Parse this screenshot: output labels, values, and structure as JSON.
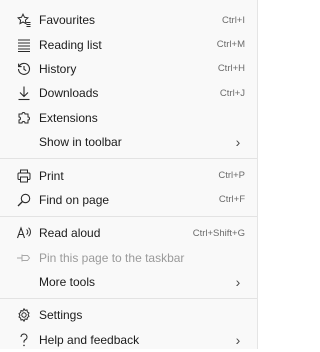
{
  "menu": {
    "groups": [
      {
        "items": [
          {
            "label": "Favourites",
            "shortcut": "Ctrl+I",
            "icon": "favourites-star-icon"
          },
          {
            "label": "Reading list",
            "shortcut": "Ctrl+M",
            "icon": "reading-list-icon"
          },
          {
            "label": "History",
            "shortcut": "Ctrl+H",
            "icon": "history-icon"
          },
          {
            "label": "Downloads",
            "shortcut": "Ctrl+J",
            "icon": "download-icon"
          },
          {
            "label": "Extensions",
            "shortcut": "",
            "icon": "extensions-icon"
          },
          {
            "label": "Show in toolbar",
            "submenu": "›"
          }
        ]
      },
      {
        "items": [
          {
            "label": "Print",
            "shortcut": "Ctrl+P",
            "icon": "print-icon"
          },
          {
            "label": "Find on page",
            "shortcut": "Ctrl+F",
            "icon": "search-icon"
          }
        ]
      },
      {
        "items": [
          {
            "label": "Read aloud",
            "shortcut": "Ctrl+Shift+G",
            "icon": "read-aloud-icon"
          },
          {
            "label": "Pin this page to the taskbar",
            "disabled": true,
            "icon": "pin-icon"
          },
          {
            "label": "More tools",
            "submenu": "›"
          }
        ]
      },
      {
        "items": [
          {
            "label": "Settings",
            "icon": "settings-gear-icon"
          },
          {
            "label": "Help and feedback",
            "submenu": "›",
            "icon": "help-icon"
          }
        ]
      }
    ]
  }
}
